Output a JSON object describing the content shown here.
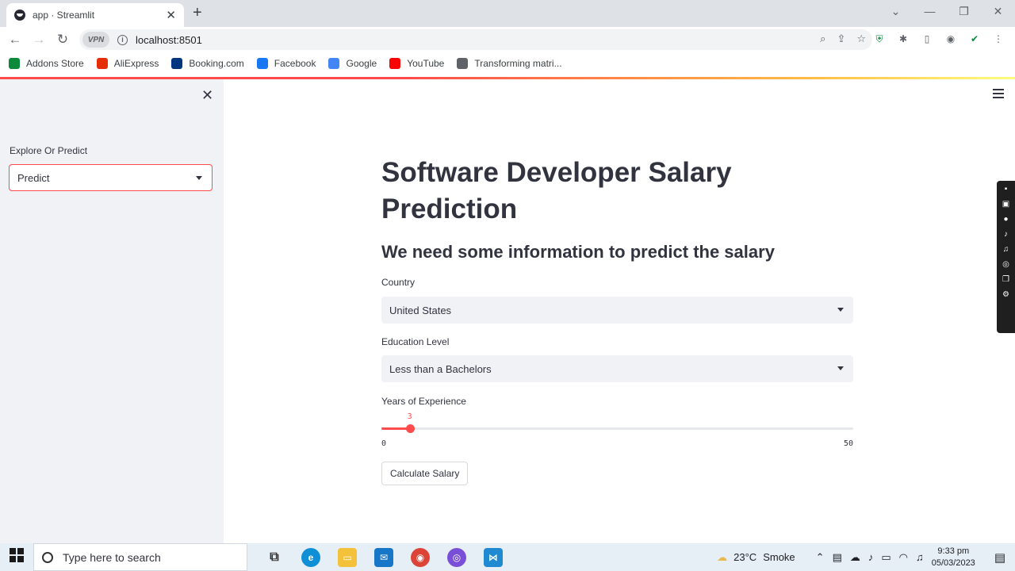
{
  "browser": {
    "tab_title": "app · Streamlit",
    "tab_close": "✕",
    "new_tab": "+",
    "url": "localhost:8501",
    "vpn_label": "VPN",
    "bookmarks": [
      {
        "label": "Addons Store",
        "color": "#0a8a3a",
        "icon": "addons-store-icon"
      },
      {
        "label": "AliExpress",
        "color": "#e62e04",
        "icon": "aliexpress-icon"
      },
      {
        "label": "Booking.com",
        "color": "#003580",
        "icon": "booking-icon"
      },
      {
        "label": "Facebook",
        "color": "#1877f2",
        "icon": "facebook-icon"
      },
      {
        "label": "Google",
        "color": "#4285f4",
        "icon": "google-icon"
      },
      {
        "label": "YouTube",
        "color": "#ff0000",
        "icon": "youtube-icon"
      },
      {
        "label": "Transforming matri...",
        "color": "#5f6368",
        "icon": "globe-icon"
      }
    ]
  },
  "sidebar": {
    "close_label": "✕",
    "select_label": "Explore Or Predict",
    "select_value": "Predict"
  },
  "main": {
    "title": "Software Developer Salary Prediction",
    "subtitle": "We need some information to predict the salary",
    "country_label": "Country",
    "country_value": "United States",
    "education_label": "Education Level",
    "education_value": "Less than a Bachelors",
    "experience_label": "Years of Experience",
    "experience_value": "3",
    "experience_min": "0",
    "experience_max": "50",
    "experience_fraction": 0.06,
    "button_label": "Calculate Salary"
  },
  "taskbar": {
    "search_placeholder": "Type here to search",
    "temperature": "23°C",
    "weather": "Smoke",
    "time": "9:33 pm",
    "date": "05/03/2023"
  },
  "colors": {
    "accent": "#ff4b4b",
    "sidebar_bg": "#f0f2f6",
    "text": "#31333f"
  }
}
